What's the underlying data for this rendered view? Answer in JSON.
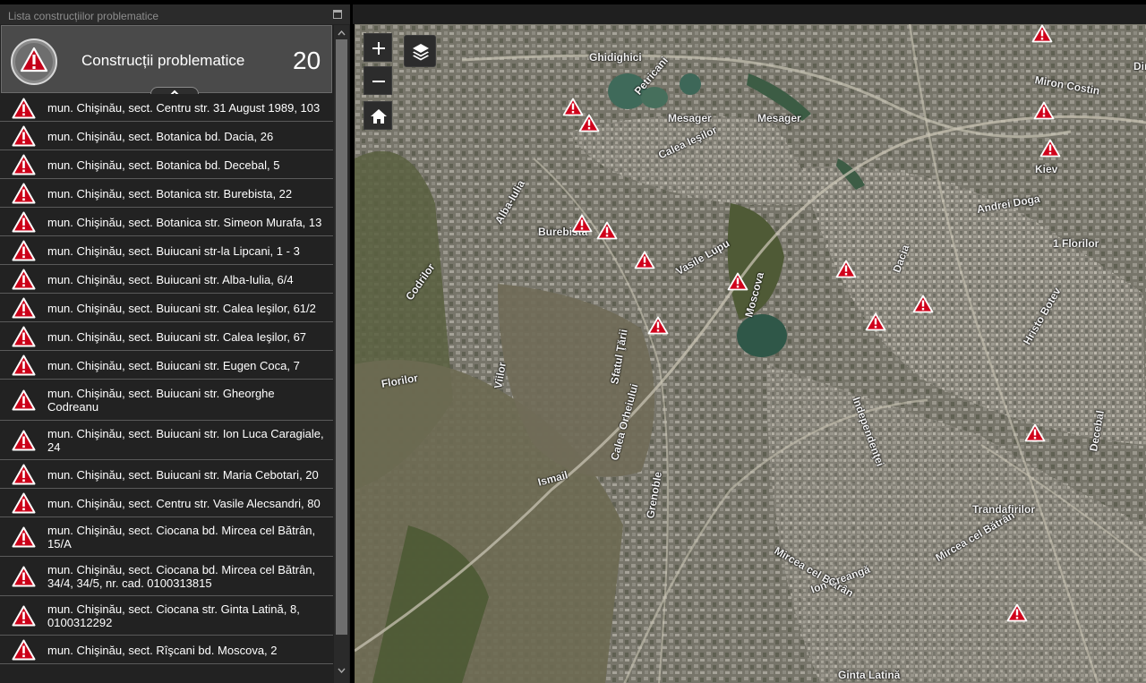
{
  "panel": {
    "title": "Lista construcțiilor problematice",
    "header_label": "Construcții problematice",
    "count": "20"
  },
  "items": [
    {
      "text": "mun. Chişinău, sect. Centru str. 31 August 1989, 103"
    },
    {
      "text": "mun. Chişinău, sect. Botanica bd. Dacia, 26"
    },
    {
      "text": "mun. Chişinău, sect. Botanica bd. Decebal, 5"
    },
    {
      "text": "mun. Chişinău, sect. Botanica str. Burebista, 22"
    },
    {
      "text": "mun. Chişinău, sect. Botanica str. Simeon Murafa, 13"
    },
    {
      "text": "mun. Chişinău, sect. Buiucani str-la Lipcani, 1 - 3"
    },
    {
      "text": "mun. Chişinău, sect. Buiucani str. Alba-Iulia, 6/4"
    },
    {
      "text": "mun. Chişinău, sect. Buiucani str. Calea Ieşilor, 61/2"
    },
    {
      "text": "mun. Chişinău, sect. Buiucani str. Calea Ieşilor, 67"
    },
    {
      "text": "mun. Chişinău, sect. Buiucani str. Eugen Coca, 7"
    },
    {
      "text": "mun. Chişinău, sect. Buiucani str. Gheorghe Codreanu"
    },
    {
      "text": "mun. Chişinău, sect. Buiucani str. Ion Luca Caragiale, 24"
    },
    {
      "text": "mun. Chişinău, sect. Buiucani str. Maria Cebotari, 20"
    },
    {
      "text": "mun. Chişinău, sect. Centru str. Vasile Alecsandri, 80"
    },
    {
      "text": "mun. Chişinău, sect. Ciocana bd. Mircea cel Bătrân, 15/A"
    },
    {
      "text": "mun. Chişinău, sect. Ciocana bd. Mircea cel Bătrân, 34/4, 34/5, nr. cad. 0100313815"
    },
    {
      "text": "mun. Chişinău, sect. Ciocana str. Ginta Latină, 8, 0100312292"
    },
    {
      "text": "mun. Chişinău, sect. Rîşcani bd. Moscova, 2"
    }
  ],
  "map": {
    "zoom_in": "+",
    "zoom_out": "−",
    "streets": [
      {
        "label": "Ghidighici"
      },
      {
        "label": "Mesager"
      },
      {
        "label": "Mesager"
      },
      {
        "label": "Calea Ieşilor"
      },
      {
        "label": "Alba-Iulia"
      },
      {
        "label": "Dacia"
      },
      {
        "label": "Decebal"
      },
      {
        "label": "Mircea cel Bătrân"
      },
      {
        "label": "Moscova"
      },
      {
        "label": "Ginta Latină"
      },
      {
        "label": "Mircea cel Bătrân"
      },
      {
        "label": "Codrilor"
      },
      {
        "label": "Florilor"
      },
      {
        "label": "Miron Costin"
      },
      {
        "label": "Kiev"
      },
      {
        "label": "Andrei Doga"
      },
      {
        "label": "1 Florilor"
      },
      {
        "label": "Ion Creangă"
      },
      {
        "label": "Vasile Lupu"
      },
      {
        "label": "Viilor"
      },
      {
        "label": "Sfatul Ţării"
      },
      {
        "label": "Grenoble"
      },
      {
        "label": "Burebista"
      },
      {
        "label": "Hristo Botev"
      },
      {
        "label": "Independenţei"
      },
      {
        "label": "Trandafirilor"
      },
      {
        "label": "Petricani"
      },
      {
        "label": "Calea Orheiului"
      },
      {
        "label": "Ismail"
      },
      {
        "label": "Dimo"
      }
    ]
  },
  "colors": {
    "panel_bg": "#222222",
    "header_bg": "#4a4a4a",
    "marker_red": "#d0021b",
    "map_green": "#5b6a46"
  }
}
